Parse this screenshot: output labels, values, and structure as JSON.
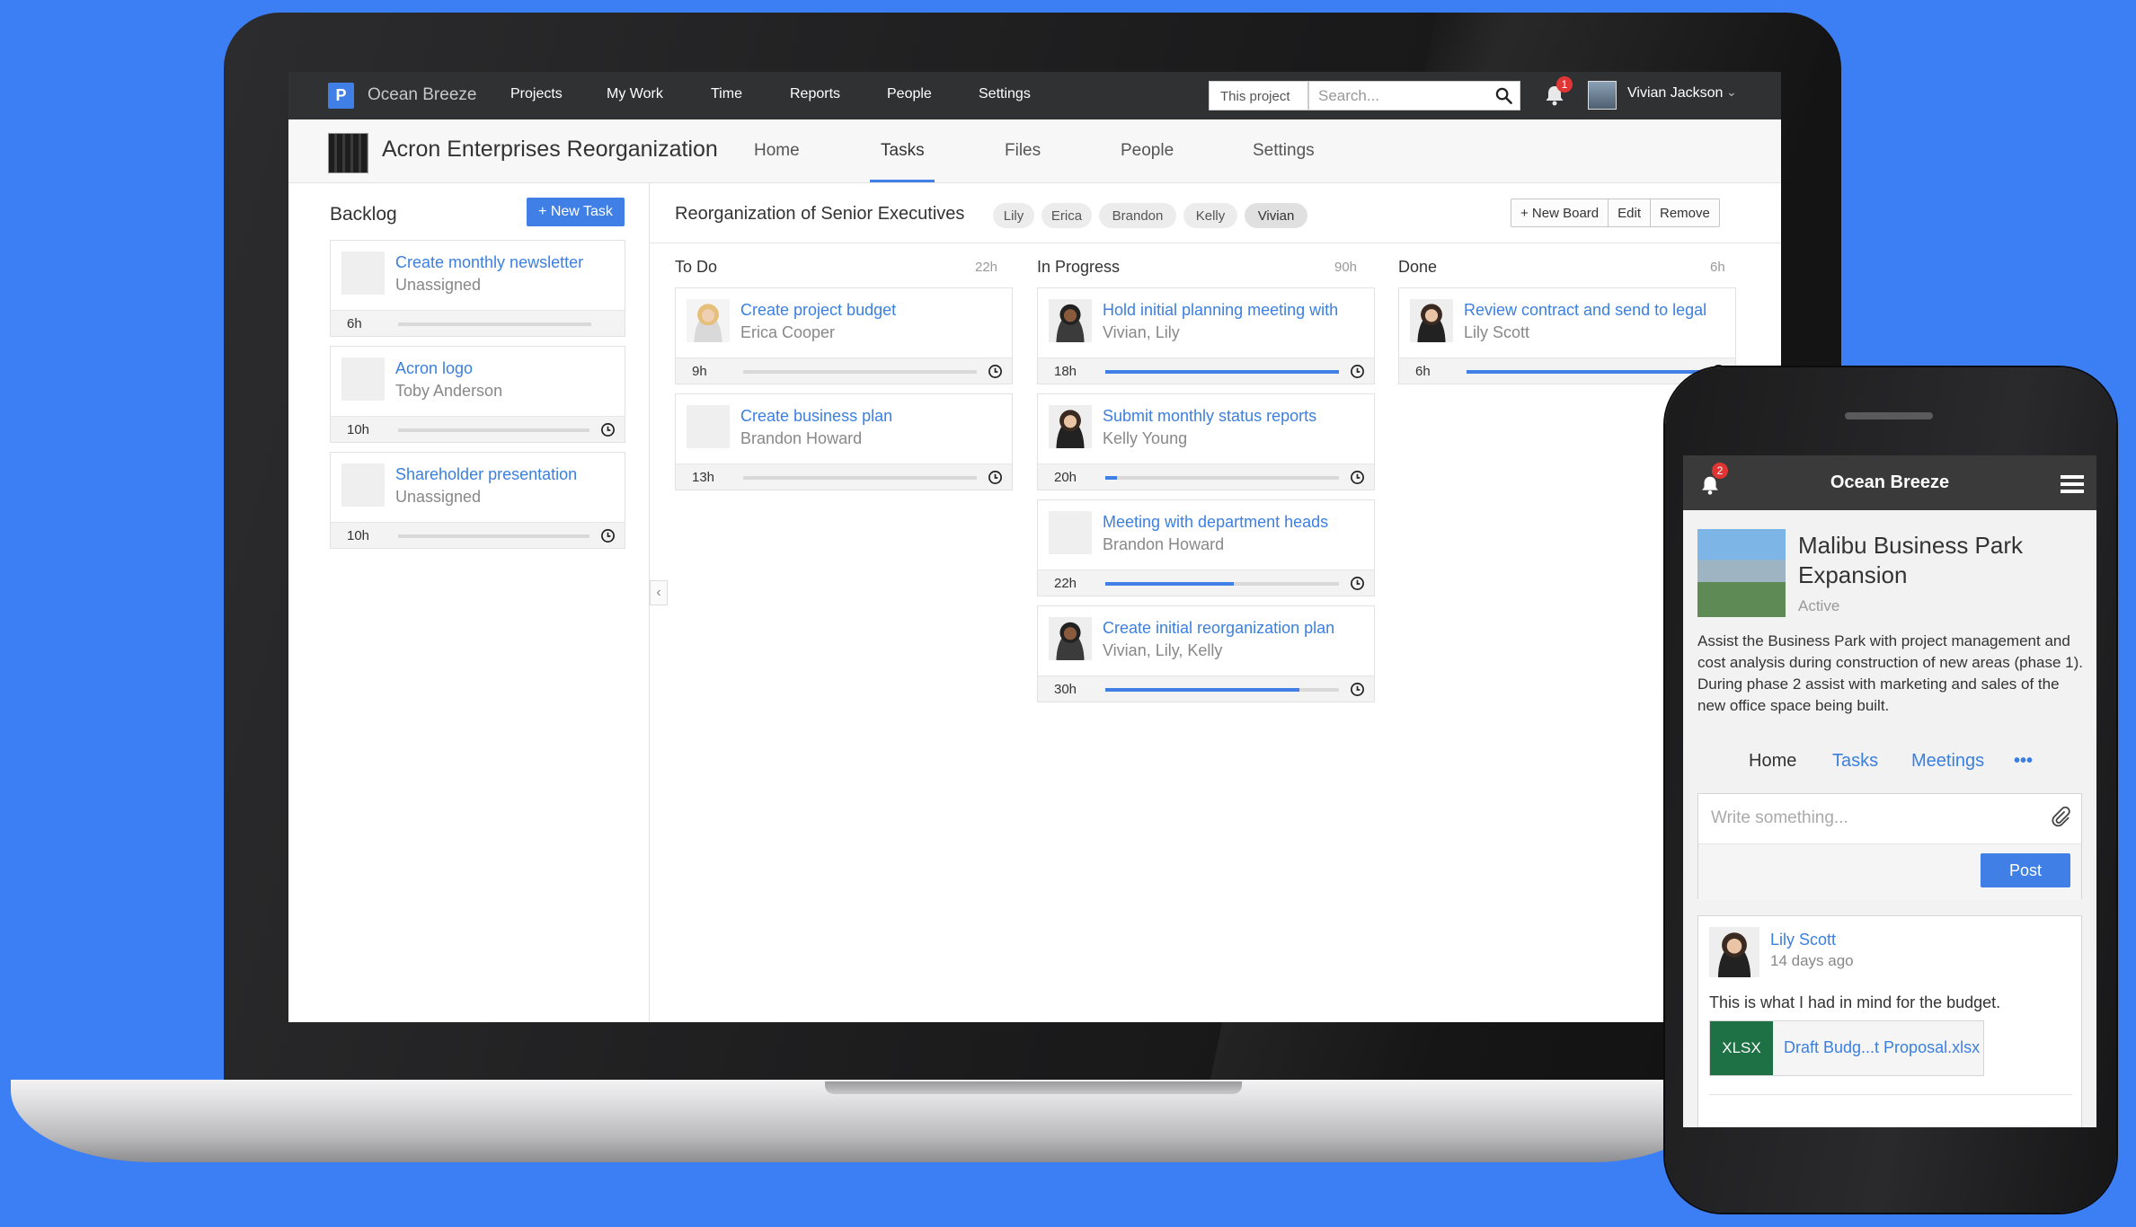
{
  "topnav": {
    "brand": "Ocean Breeze",
    "logo_letter": "P",
    "items": [
      "Projects",
      "My Work",
      "Time",
      "Reports",
      "People",
      "Settings"
    ],
    "search_scope": "This project",
    "search_placeholder": "Search...",
    "notifications_count": "1",
    "user_name": "Vivian Jackson"
  },
  "project": {
    "title": "Acron Enterprises Reorganization",
    "tabs": [
      "Home",
      "Tasks",
      "Files",
      "People",
      "Settings"
    ],
    "active_tab": "Tasks"
  },
  "backlog": {
    "title": "Backlog",
    "new_task_label": "+ New Task",
    "cards": [
      {
        "title": "Create monthly newsletter",
        "assignee": "Unassigned",
        "hours": "6h",
        "progress": 0
      },
      {
        "title": "Acron logo",
        "assignee": "Toby Anderson",
        "hours": "10h",
        "progress": 0
      },
      {
        "title": "Shareholder presentation",
        "assignee": "Unassigned",
        "hours": "10h",
        "progress": 0
      }
    ]
  },
  "board": {
    "title": "Reorganization of Senior Executives",
    "filters": [
      "Lily",
      "Erica",
      "Brandon",
      "Kelly",
      "Vivian"
    ],
    "selected_filter": "Vivian",
    "actions": [
      "+ New Board",
      "Edit",
      "Remove"
    ],
    "columns": [
      {
        "name": "To Do",
        "hours": "22h",
        "cards": [
          {
            "title": "Create project budget",
            "assignee": "Erica Cooper",
            "hours": "9h",
            "progress": 0
          },
          {
            "title": "Create business plan",
            "assignee": "Brandon Howard",
            "hours": "13h",
            "progress": 0
          }
        ]
      },
      {
        "name": "In Progress",
        "hours": "90h",
        "cards": [
          {
            "title": "Hold initial planning meeting with",
            "assignee": "Vivian, Lily",
            "hours": "18h",
            "progress": 1.0
          },
          {
            "title": "Submit monthly status reports",
            "assignee": "Kelly Young",
            "hours": "20h",
            "progress": 0.05
          },
          {
            "title": "Meeting with department heads",
            "assignee": "Brandon Howard",
            "hours": "22h",
            "progress": 0.55
          },
          {
            "title": "Create initial reorganization plan",
            "assignee": "Vivian, Lily, Kelly",
            "hours": "30h",
            "progress": 0.83
          }
        ]
      },
      {
        "name": "Done",
        "hours": "6h",
        "cards": [
          {
            "title": "Review contract and send to legal",
            "assignee": "Lily Scott",
            "hours": "6h",
            "progress": 1.0
          }
        ]
      }
    ]
  },
  "mobile": {
    "brand": "Ocean Breeze",
    "notifications_count": "2",
    "project_title": "Malibu Business Park Expansion",
    "project_status": "Active",
    "project_description": "Assist the Business Park with project management and cost analysis during construction of new areas (phase 1). During phase 2 assist with marketing and sales of the new office space being built.",
    "tabs": [
      "Home",
      "Tasks",
      "Meetings",
      "•••"
    ],
    "write_placeholder": "Write something...",
    "post_label": "Post",
    "feed": {
      "author": "Lily Scott",
      "time": "14 days ago",
      "text": "This is what I had in mind for the budget.",
      "attachment_type": "XLSX",
      "attachment_name": "Draft Budg...t Proposal.xlsx"
    }
  },
  "colors": {
    "background": "#3c7ef4",
    "accent": "#3f7fe6",
    "link": "#3b7fe0",
    "nav": "#2f3133"
  }
}
